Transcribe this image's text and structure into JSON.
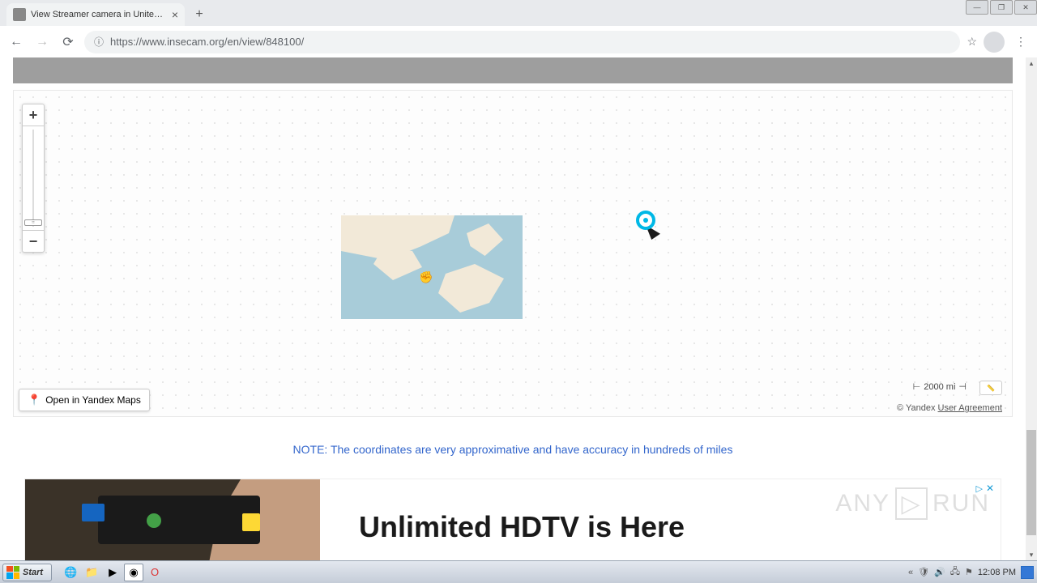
{
  "browser": {
    "tab_title": "View Streamer camera in United Sta",
    "url_display": "https://www.insecam.org/en/view/848100/",
    "new_tab_label": "+"
  },
  "map": {
    "open_maps_label": "Open in Yandex Maps",
    "scale_text": "2000 mi",
    "copyright_prefix": "© Yandex ",
    "user_agreement": "User Agreement",
    "zoom_in": "+",
    "zoom_out": "−"
  },
  "note": "NOTE: The coordinates are very approximative and have accuracy in hundreds of miles",
  "ad": {
    "headline": "Unlimited HDTV is Here",
    "badge_icon": "▷",
    "close": "✕"
  },
  "watermark": {
    "text_left": "ANY",
    "text_right": "RUN",
    "play": "▷"
  },
  "taskbar": {
    "start": "Start",
    "clock": "12:08 PM"
  }
}
